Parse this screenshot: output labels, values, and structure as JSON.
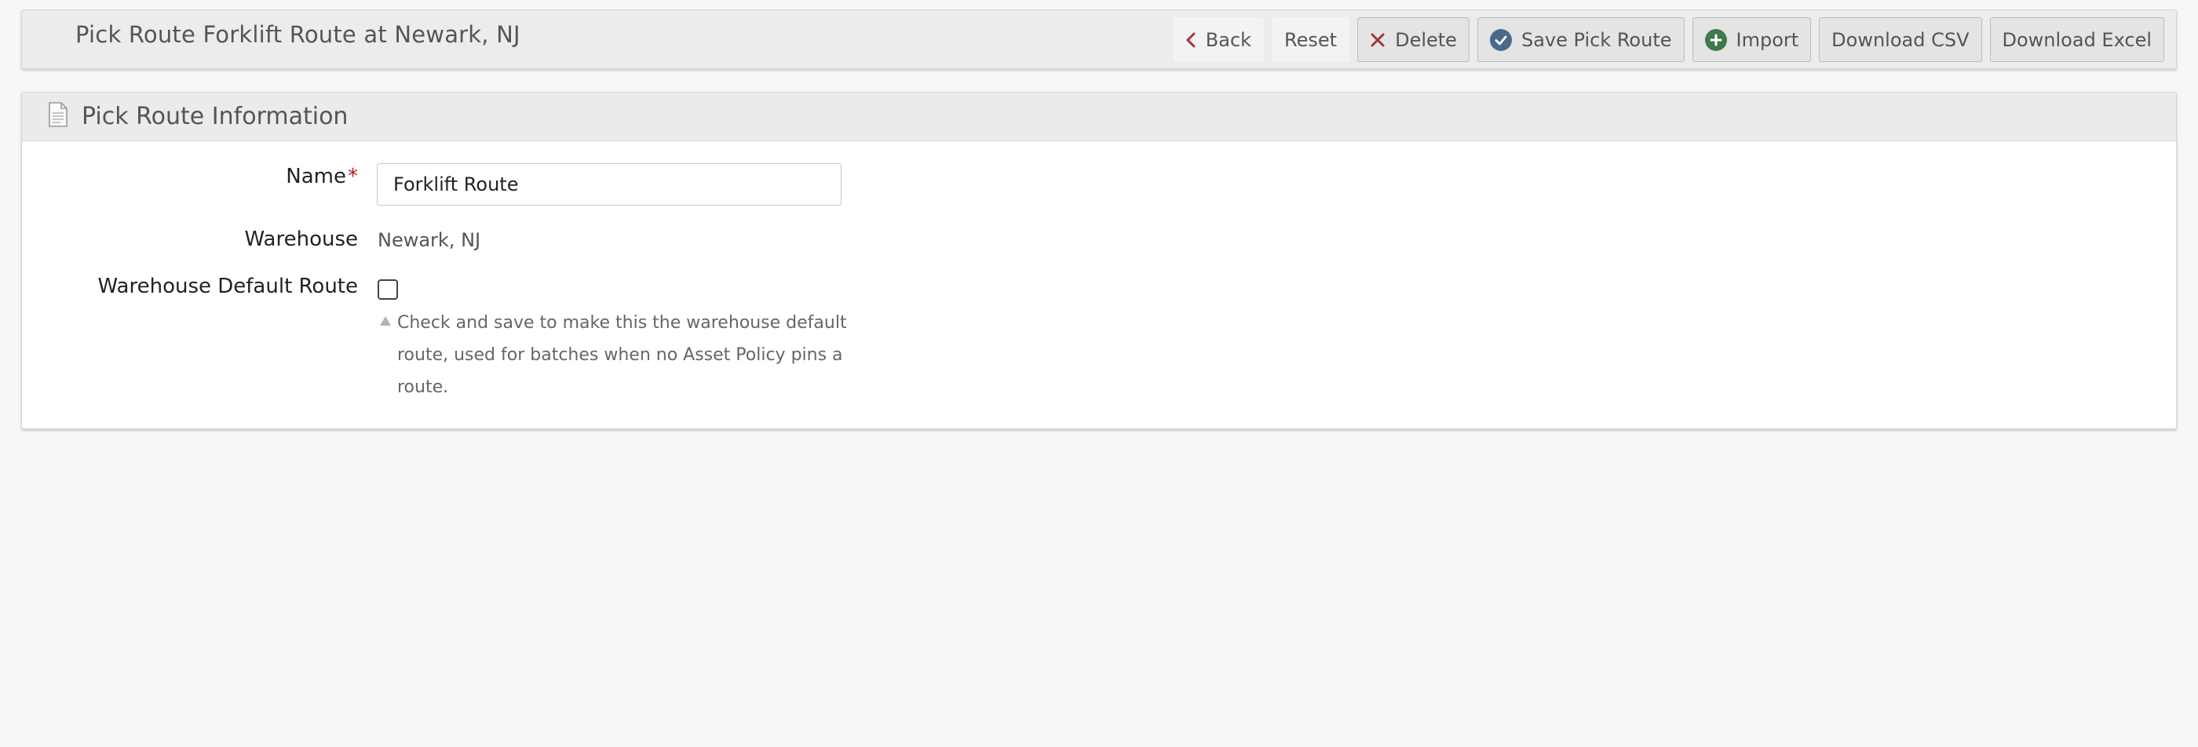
{
  "header": {
    "title": "Pick Route Forklift Route at Newark, NJ"
  },
  "toolbar": {
    "back_label": "Back",
    "reset_label": "Reset",
    "delete_label": "Delete",
    "save_label": "Save Pick Route",
    "import_label": "Import",
    "download_csv_label": "Download CSV",
    "download_excel_label": "Download Excel"
  },
  "panel": {
    "title": "Pick Route Information",
    "fields": {
      "name": {
        "label": "Name",
        "required_marker": "*",
        "value": "Forklift Route"
      },
      "warehouse": {
        "label": "Warehouse",
        "value": "Newark, NJ"
      },
      "default_route": {
        "label": "Warehouse Default Route",
        "checked": false,
        "help": "Check and save to make this the warehouse default route, used for batches when no Asset Policy pins a route."
      }
    }
  },
  "icons": {
    "back": "chevron-left-icon",
    "delete": "close-icon",
    "save": "check-circle-icon",
    "import": "plus-circle-icon",
    "panel": "document-icon",
    "help": "triangle-up-icon"
  },
  "colors": {
    "back_icon": "#a0363a",
    "delete_icon": "#a0363a",
    "save_icon": "#4a6a8a",
    "import_icon": "#3f7a4a",
    "required": "#c0161c",
    "help_arrow": "#a9b9ad"
  }
}
